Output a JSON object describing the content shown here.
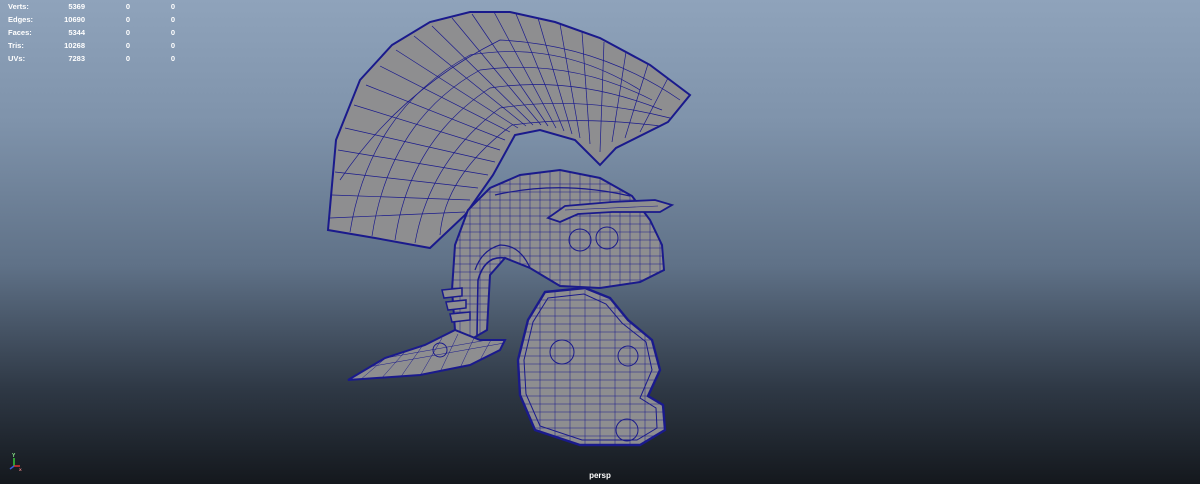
{
  "viewport": {
    "camera_label": "persp",
    "axis": {
      "y_label": "Y",
      "x_label": "X"
    },
    "colors": {
      "background_top": "#8fa3bb",
      "background_bottom": "#14181d",
      "mesh_fill": "#8e8e90",
      "wireframe": "#1a1a8c"
    }
  },
  "poly_count": {
    "rows": [
      {
        "label": "Verts:",
        "values": [
          "5369",
          "0",
          "0"
        ]
      },
      {
        "label": "Edges:",
        "values": [
          "10690",
          "0",
          "0"
        ]
      },
      {
        "label": "Faces:",
        "values": [
          "5344",
          "0",
          "0"
        ]
      },
      {
        "label": "Tris:",
        "values": [
          "10268",
          "0",
          "0"
        ]
      },
      {
        "label": "UVs:",
        "values": [
          "7283",
          "0",
          "0"
        ]
      }
    ]
  }
}
